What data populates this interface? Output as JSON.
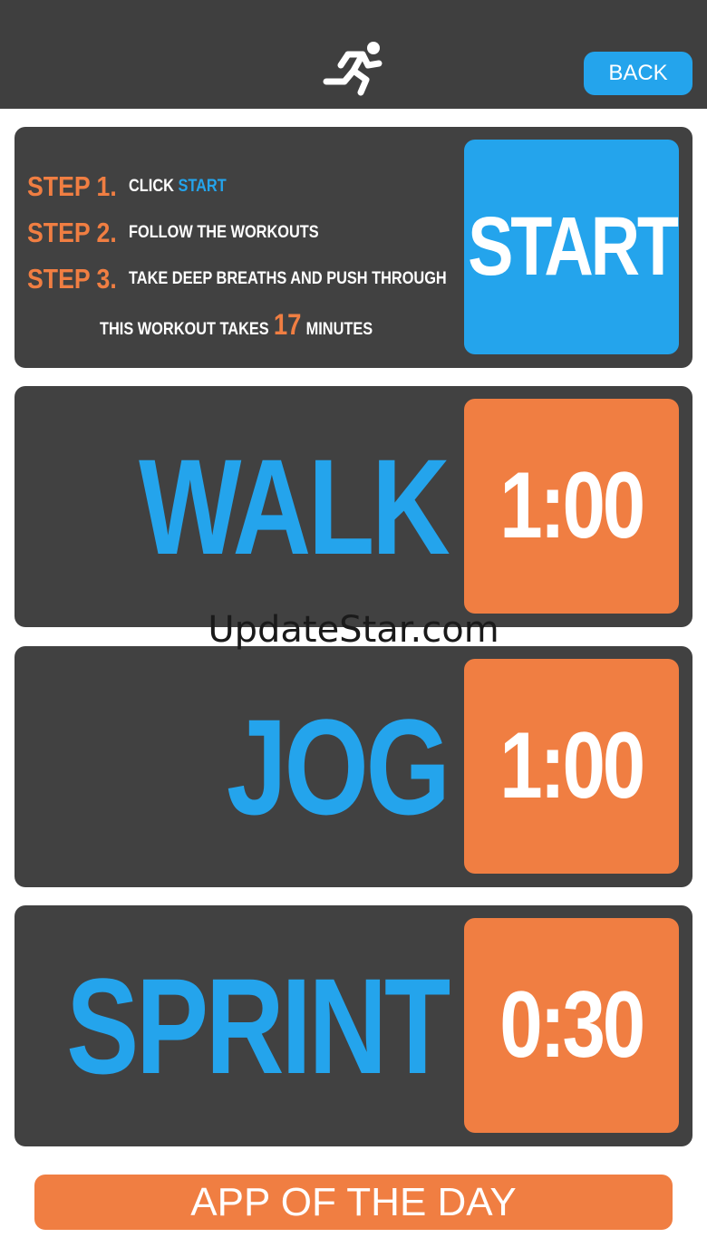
{
  "header": {
    "back_label": "BACK",
    "icon": "running-person-icon"
  },
  "intro": {
    "steps": [
      {
        "label": "STEP 1.",
        "text_prefix": "CLICK ",
        "text_highlight": "START"
      },
      {
        "label": "STEP 2.",
        "text": "FOLLOW THE WORKOUTS"
      },
      {
        "label": "STEP 3.",
        "text": "TAKE DEEP BREATHS AND PUSH THROUGH"
      }
    ],
    "duration_prefix": "THIS WORKOUT TAKES",
    "duration_value": "17",
    "duration_suffix": "MINUTES",
    "start_label": "START"
  },
  "workouts": [
    {
      "name": "WALK",
      "time": "1:00"
    },
    {
      "name": "JOG",
      "time": "1:00"
    },
    {
      "name": "SPRINT",
      "time": "0:30"
    }
  ],
  "watermark": "UpdateStar.com",
  "footer": {
    "app_of_the_day": "APP OF THE DAY"
  },
  "colors": {
    "bar": "#3f3f3f",
    "panel": "#414141",
    "blue": "#24a4ec",
    "orange": "#f07e42"
  }
}
